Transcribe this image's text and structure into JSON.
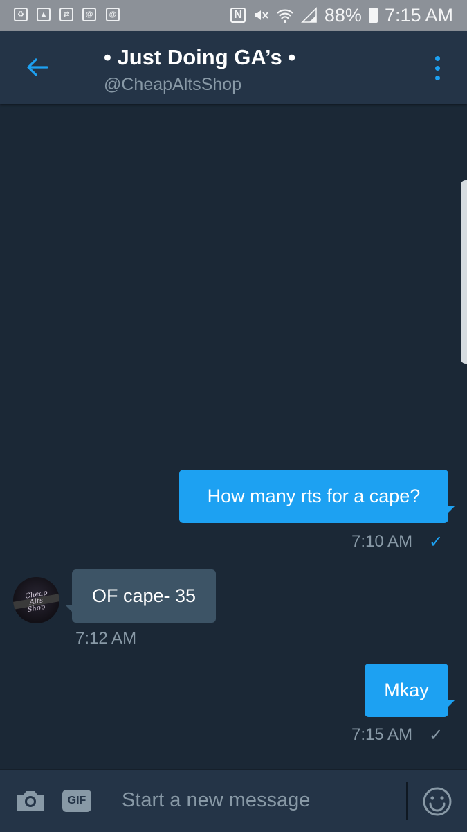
{
  "status_bar": {
    "icons": [
      "recycle-icon",
      "image-icon",
      "retweet-icon",
      "at-icon",
      "at-icon",
      "nfc-icon",
      "mute-icon",
      "wifi-icon",
      "signal-icon",
      "battery-icon"
    ],
    "notif_at_1": "@",
    "notif_at_2": "@",
    "nfc_glyph": "N",
    "battery": "88%",
    "time": "7:15 AM"
  },
  "header": {
    "title": "• Just Doing GA’s •",
    "handle": "@CheapAltsShop"
  },
  "messages": [
    {
      "direction": "outgoing",
      "text": "How many rts for a cape?",
      "time": "7:10 AM",
      "status": "✓",
      "status_color": "#1da1f2"
    },
    {
      "direction": "incoming",
      "text": "OF cape- 35",
      "time": "7:12 AM",
      "avatar_text": [
        "Cheap",
        "Alts",
        "Shop"
      ]
    },
    {
      "direction": "outgoing",
      "text": "Mkay",
      "time": "7:15 AM",
      "status": "✓",
      "status_color": "#8899a6"
    }
  ],
  "composer": {
    "gif_label": "GIF",
    "placeholder": "Start a new message"
  },
  "colors": {
    "background": "#1b2836",
    "header": "#243447",
    "accent": "#1da1f2",
    "incoming_bubble": "#3d5466",
    "muted_text": "#8899a6"
  }
}
